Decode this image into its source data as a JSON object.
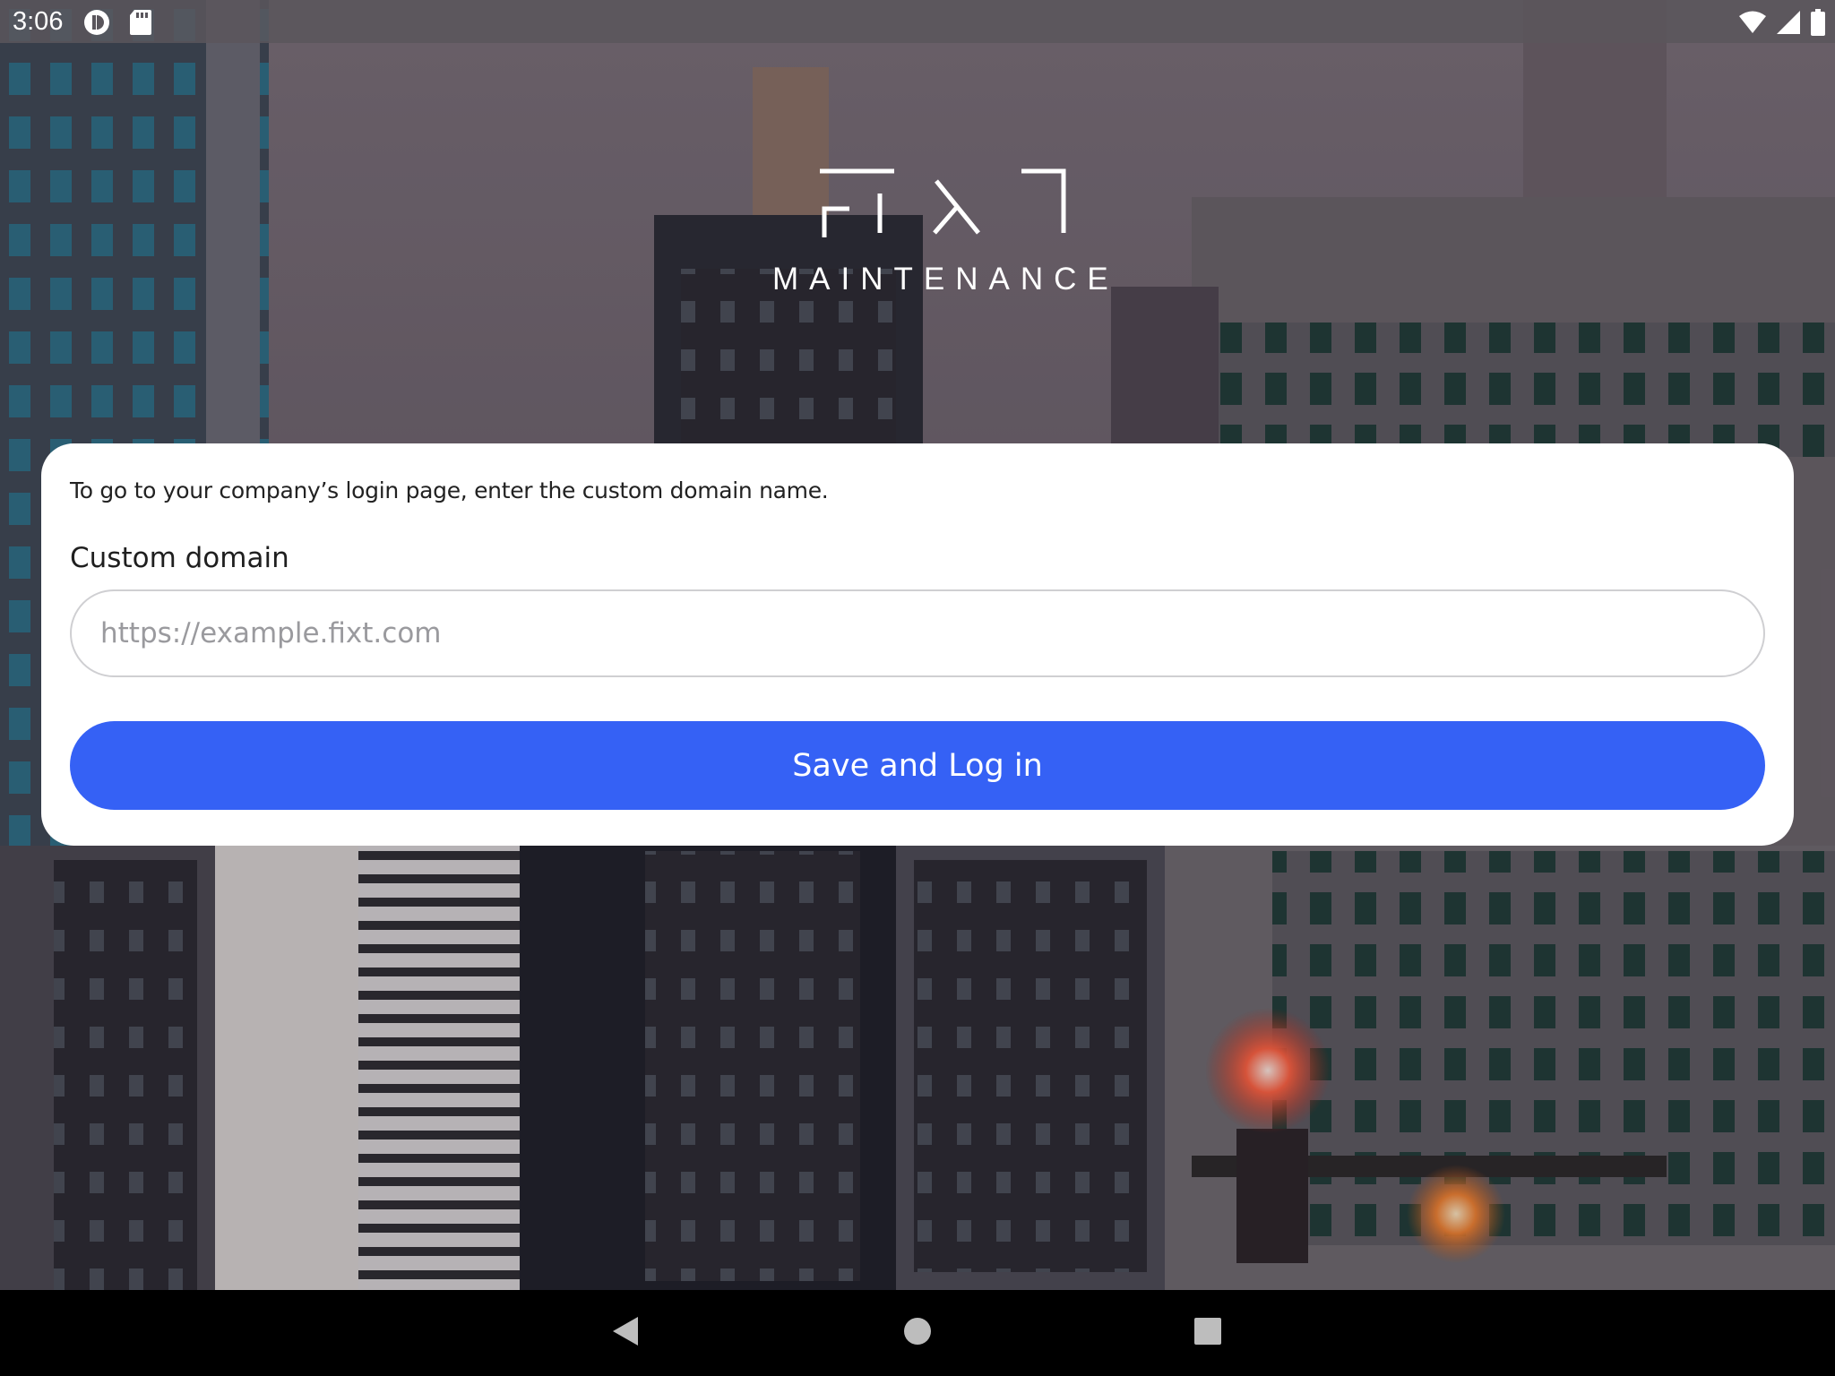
{
  "status_bar": {
    "time": "3:06",
    "left_icons": [
      "vpn-key-icon",
      "sd-card-icon"
    ],
    "right_icons": [
      "wifi-icon",
      "cell-signal-icon",
      "battery-icon"
    ]
  },
  "logo": {
    "subtitle": "MAINTENANCE"
  },
  "card": {
    "intro": "To go to your company’s login page, enter the custom domain name.",
    "field_label": "Custom domain",
    "input_value": "",
    "input_placeholder": "https://example.fixt.com",
    "button_label": "Save and Log in"
  },
  "colors": {
    "accent": "#3561f5",
    "card_bg": "#ffffff",
    "nav_bg": "#000000"
  },
  "nav_bar": {
    "buttons": [
      "back-icon",
      "home-icon",
      "recents-icon"
    ]
  }
}
